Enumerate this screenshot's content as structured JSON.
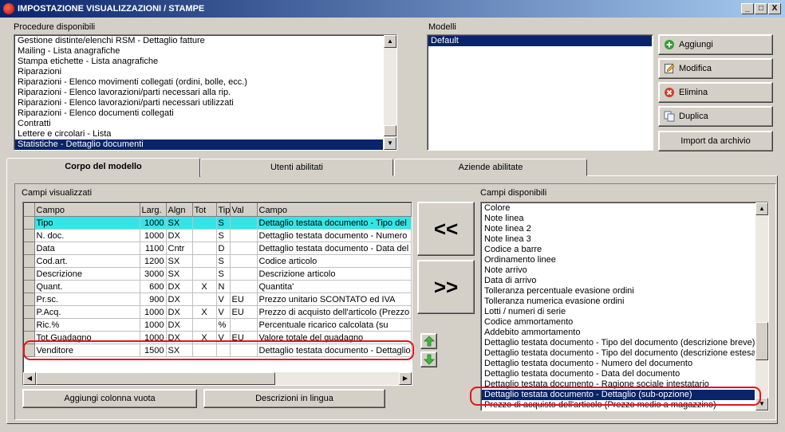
{
  "window": {
    "title": "IMPOSTAZIONE VISUALIZZAZIONI / STAMPE",
    "controls": [
      "_",
      "□",
      "X"
    ]
  },
  "procedure": {
    "label": "Procedure disponibili",
    "items": [
      "Gestione distinte/elenchi RSM - Dettaglio fatture",
      "Mailing - Lista anagrafiche",
      "Stampa etichette - Lista anagrafiche",
      "Riparazioni",
      "Riparazioni - Elenco movimenti collegati (ordini, bolle, ecc.)",
      "Riparazioni - Elenco lavorazioni/parti necessari alla rip.",
      "Riparazioni - Elenco lavorazioni/parti necessari utilizzati",
      "Riparazioni - Elenco documenti collegati",
      "Contratti",
      "Lettere e circolari - Lista",
      "Statistiche - Dettaglio documenti"
    ],
    "selected_index": 10
  },
  "modelli": {
    "label": "Modelli",
    "items": [
      "Default"
    ],
    "selected_index": 0
  },
  "buttons": {
    "aggiungi": "Aggiungi",
    "modifica": "Modifica",
    "elimina": "Elimina",
    "duplica": "Duplica",
    "import": "Import da archivio",
    "move_left": "<<",
    "move_right": ">>",
    "aggiungi_colonna": "Aggiungi colonna vuota",
    "descrizioni_lingua": "Descrizioni in lingua"
  },
  "tabs": [
    {
      "label": "Corpo del modello",
      "active": true
    },
    {
      "label": "Utenti abilitati",
      "active": false
    },
    {
      "label": "Aziende abilitate",
      "active": false
    }
  ],
  "campi_visualizzati": {
    "label": "Campi visualizzati",
    "columns": [
      "Campo",
      "Larg.",
      "Algn",
      "Tot",
      "Tip",
      "Val",
      "Campo"
    ],
    "rows": [
      {
        "campo": "Tipo",
        "larg": "1000",
        "algn": "SX",
        "tot": "",
        "tip": "S",
        "val": "",
        "desc": "Dettaglio testata documento - Tipo del"
      },
      {
        "campo": "N. doc.",
        "larg": "1000",
        "algn": "DX",
        "tot": "",
        "tip": "S",
        "val": "",
        "desc": "Dettaglio testata documento - Numero"
      },
      {
        "campo": "Data",
        "larg": "1100",
        "algn": "Cntr",
        "tot": "",
        "tip": "D",
        "val": "",
        "desc": "Dettaglio testata documento - Data del"
      },
      {
        "campo": "Cod.art.",
        "larg": "1200",
        "algn": "SX",
        "tot": "",
        "tip": "S",
        "val": "",
        "desc": "Codice articolo"
      },
      {
        "campo": "Descrizione",
        "larg": "3000",
        "algn": "SX",
        "tot": "",
        "tip": "S",
        "val": "",
        "desc": "Descrizione articolo"
      },
      {
        "campo": "Quant.",
        "larg": "600",
        "algn": "DX",
        "tot": "X",
        "tip": "N",
        "val": "",
        "desc": "Quantita'"
      },
      {
        "campo": "Pr.sc.",
        "larg": "900",
        "algn": "DX",
        "tot": "",
        "tip": "V",
        "val": "EU",
        "desc": "Prezzo unitario SCONTATO ed IVA"
      },
      {
        "campo": "P.Acq.",
        "larg": "1000",
        "algn": "DX",
        "tot": "X",
        "tip": "V",
        "val": "EU",
        "desc": "Prezzo di acquisto dell'articolo (Prezzo"
      },
      {
        "campo": "Ric.%",
        "larg": "1000",
        "algn": "DX",
        "tot": "",
        "tip": "%",
        "val": "",
        "desc": "Percentuale ricarico calcolata (su"
      },
      {
        "campo": "Tot.Guadagno",
        "larg": "1000",
        "algn": "DX",
        "tot": "X",
        "tip": "V",
        "val": "EU",
        "desc": "Valore totale del guadagno"
      },
      {
        "campo": "Venditore",
        "larg": "1500",
        "algn": "SX",
        "tot": "",
        "tip": "",
        "val": "",
        "desc": "Dettaglio testata documento - Dettaglio"
      }
    ]
  },
  "campi_disponibili": {
    "label": "Campi disponibili",
    "items": [
      "Colore",
      "Note linea",
      "Note linea 2",
      "Note linea 3",
      "Codice a barre",
      "Ordinamento linee",
      "Note arrivo",
      "Data di arrivo",
      "Tolleranza percentuale evasione ordini",
      "Tolleranza numerica evasione ordini",
      "Lotti / numeri di serie",
      "Codice ammortamento",
      "Addebito ammortamento",
      "Dettaglio testata documento - Tipo del documento (descrizione breve)",
      "Dettaglio testata documento - Tipo del documento (descrizione estesa)",
      "Dettaglio testata documento - Numero del documento",
      "Dettaglio testata documento - Data del documento",
      "Dettaglio testata documento - Ragione sociale intestatario",
      "Dettaglio testata documento - Dettaglio (sub-opzione)",
      "Prezzo di acquisto dell'articolo (Prezzo medio a magazzino)"
    ],
    "selected_index": 18
  },
  "colors": {
    "selection": "#0a246a",
    "highlight_row": "#33e6e6",
    "annotation": "#e4141a"
  }
}
